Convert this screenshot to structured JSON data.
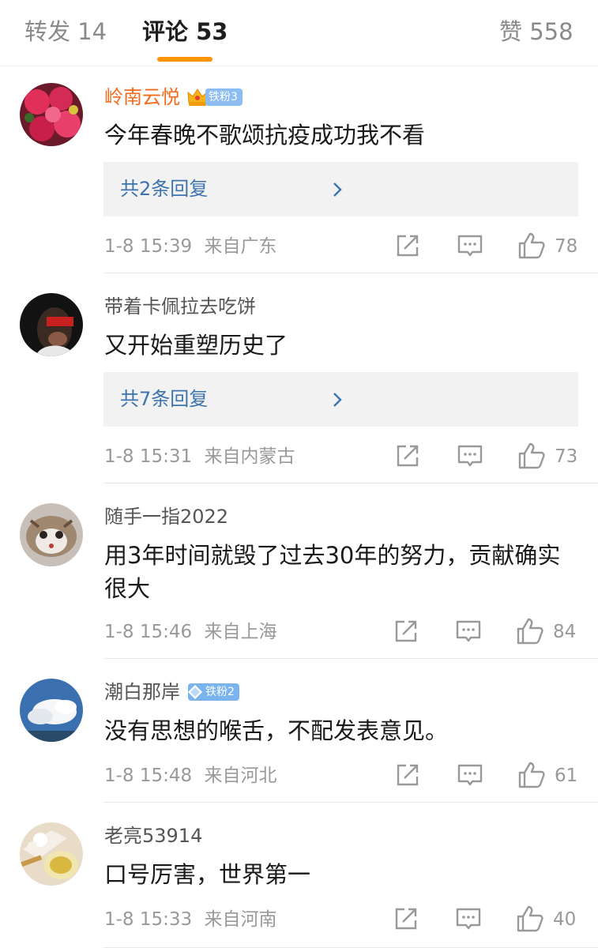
{
  "tabs": {
    "repost": "转发 14",
    "comments": "评论 53",
    "likes": "赞 558"
  },
  "colors": {
    "accent": "#ff9400",
    "vip_name": "#f26b1d",
    "reply_link": "#3d73ad",
    "meta": "#999999"
  },
  "comments": [
    {
      "user": "岭南云悦",
      "badge": "铁粉3",
      "badge_icon": "crown-icon",
      "text": "今年春晚不歌颂抗疫成功我不看",
      "replies": "共2条回复",
      "time": "1-8 15:39",
      "source": "来自广东",
      "likes": "78"
    },
    {
      "user": "带着卡佩拉去吃饼",
      "text": "又开始重塑历史了",
      "replies": "共7条回复",
      "time": "1-8 15:31",
      "source": "来自内蒙古",
      "likes": "73"
    },
    {
      "user": "随手一指2022",
      "text": "用3年时间就毁了过去30年的努力，贡献确实很大",
      "time": "1-8 15:46",
      "source": "来自上海",
      "likes": "84"
    },
    {
      "user": "潮白那岸",
      "badge": "铁粉2",
      "badge_icon": "diamond-icon",
      "text": "没有思想的喉舌，不配发表意见。",
      "time": "1-8 15:48",
      "source": "来自河北",
      "likes": "61"
    },
    {
      "user": "老亮53914",
      "text": "口号厉害，世界第一",
      "time": "1-8 15:33",
      "source": "来自河南",
      "likes": "40"
    }
  ]
}
